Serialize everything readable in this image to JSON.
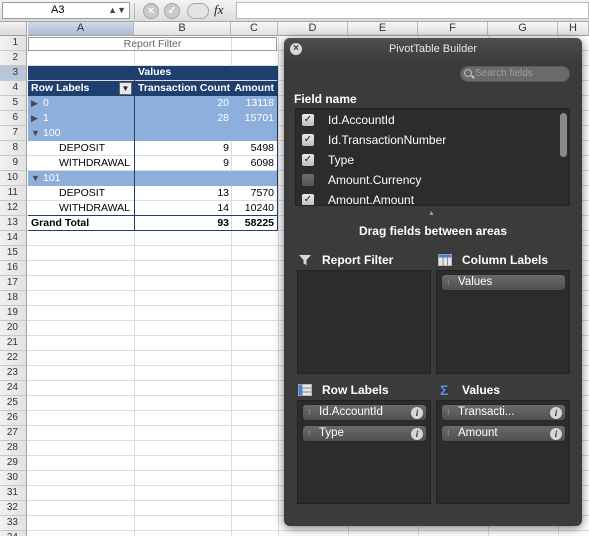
{
  "formula_bar": {
    "name_box": "A3",
    "cancel_glyph": "×",
    "confirm_glyph": "✓",
    "fx_label": "fx",
    "formula": ""
  },
  "columns": [
    "A",
    "B",
    "C",
    "D",
    "E",
    "F",
    "G",
    "H"
  ],
  "rows": [
    "1",
    "2",
    "3",
    "4",
    "5",
    "6",
    "7",
    "8",
    "9",
    "10",
    "11",
    "12",
    "13",
    "14",
    "15",
    "16",
    "17",
    "18",
    "19",
    "20",
    "21",
    "22",
    "23",
    "24",
    "25",
    "26",
    "27",
    "28",
    "29",
    "30",
    "31",
    "32",
    "33",
    "34"
  ],
  "pivot_table": {
    "report_filter_label": "Report Filter",
    "values_header": "Values",
    "row_labels_header": "Row Labels",
    "col_transaction_count": "Transaction Count",
    "col_amount": "Amount",
    "rows": [
      {
        "label": "0",
        "count": "20",
        "amount": "13118",
        "collapsed": true
      },
      {
        "label": "1",
        "count": "28",
        "amount": "15701",
        "collapsed": true
      },
      {
        "label": "100",
        "count": "",
        "amount": "",
        "collapsed": false
      },
      {
        "label": "DEPOSIT",
        "count": "9",
        "amount": "5498",
        "child": true
      },
      {
        "label": "WITHDRAWAL",
        "count": "9",
        "amount": "6098",
        "child": true
      },
      {
        "label": "101",
        "count": "",
        "amount": "",
        "collapsed": false
      },
      {
        "label": "DEPOSIT",
        "count": "13",
        "amount": "7570",
        "child": true
      },
      {
        "label": "WITHDRAWAL",
        "count": "14",
        "amount": "10240",
        "child": true
      }
    ],
    "grand_total_label": "Grand Total",
    "grand_total_count": "93",
    "grand_total_amount": "58225"
  },
  "pivot_builder": {
    "title": "PivotTable Builder",
    "search_placeholder": "Search fields",
    "field_name_header": "Field name",
    "fields": [
      {
        "label": "Id.AccountId",
        "checked": true
      },
      {
        "label": "Id.TransactionNumber",
        "checked": true
      },
      {
        "label": "Type",
        "checked": true
      },
      {
        "label": "Amount.Currency",
        "checked": false
      },
      {
        "label": "Amount.Amount",
        "checked": true
      }
    ],
    "drag_hint": "Drag fields between areas",
    "areas": {
      "report_filter": {
        "label": "Report Filter",
        "items": []
      },
      "column_labels": {
        "label": "Column Labels",
        "items": [
          "Values"
        ]
      },
      "row_labels": {
        "label": "Row Labels",
        "items": [
          "Id.AccountId",
          "Type"
        ]
      },
      "values": {
        "label": "Values",
        "items": [
          "Transacti...",
          "Amount"
        ]
      }
    }
  },
  "colors": {
    "pivot_header": "#1f3f6e",
    "pivot_band": "#8eaedc",
    "panel_bg": "#3b3b3b"
  }
}
